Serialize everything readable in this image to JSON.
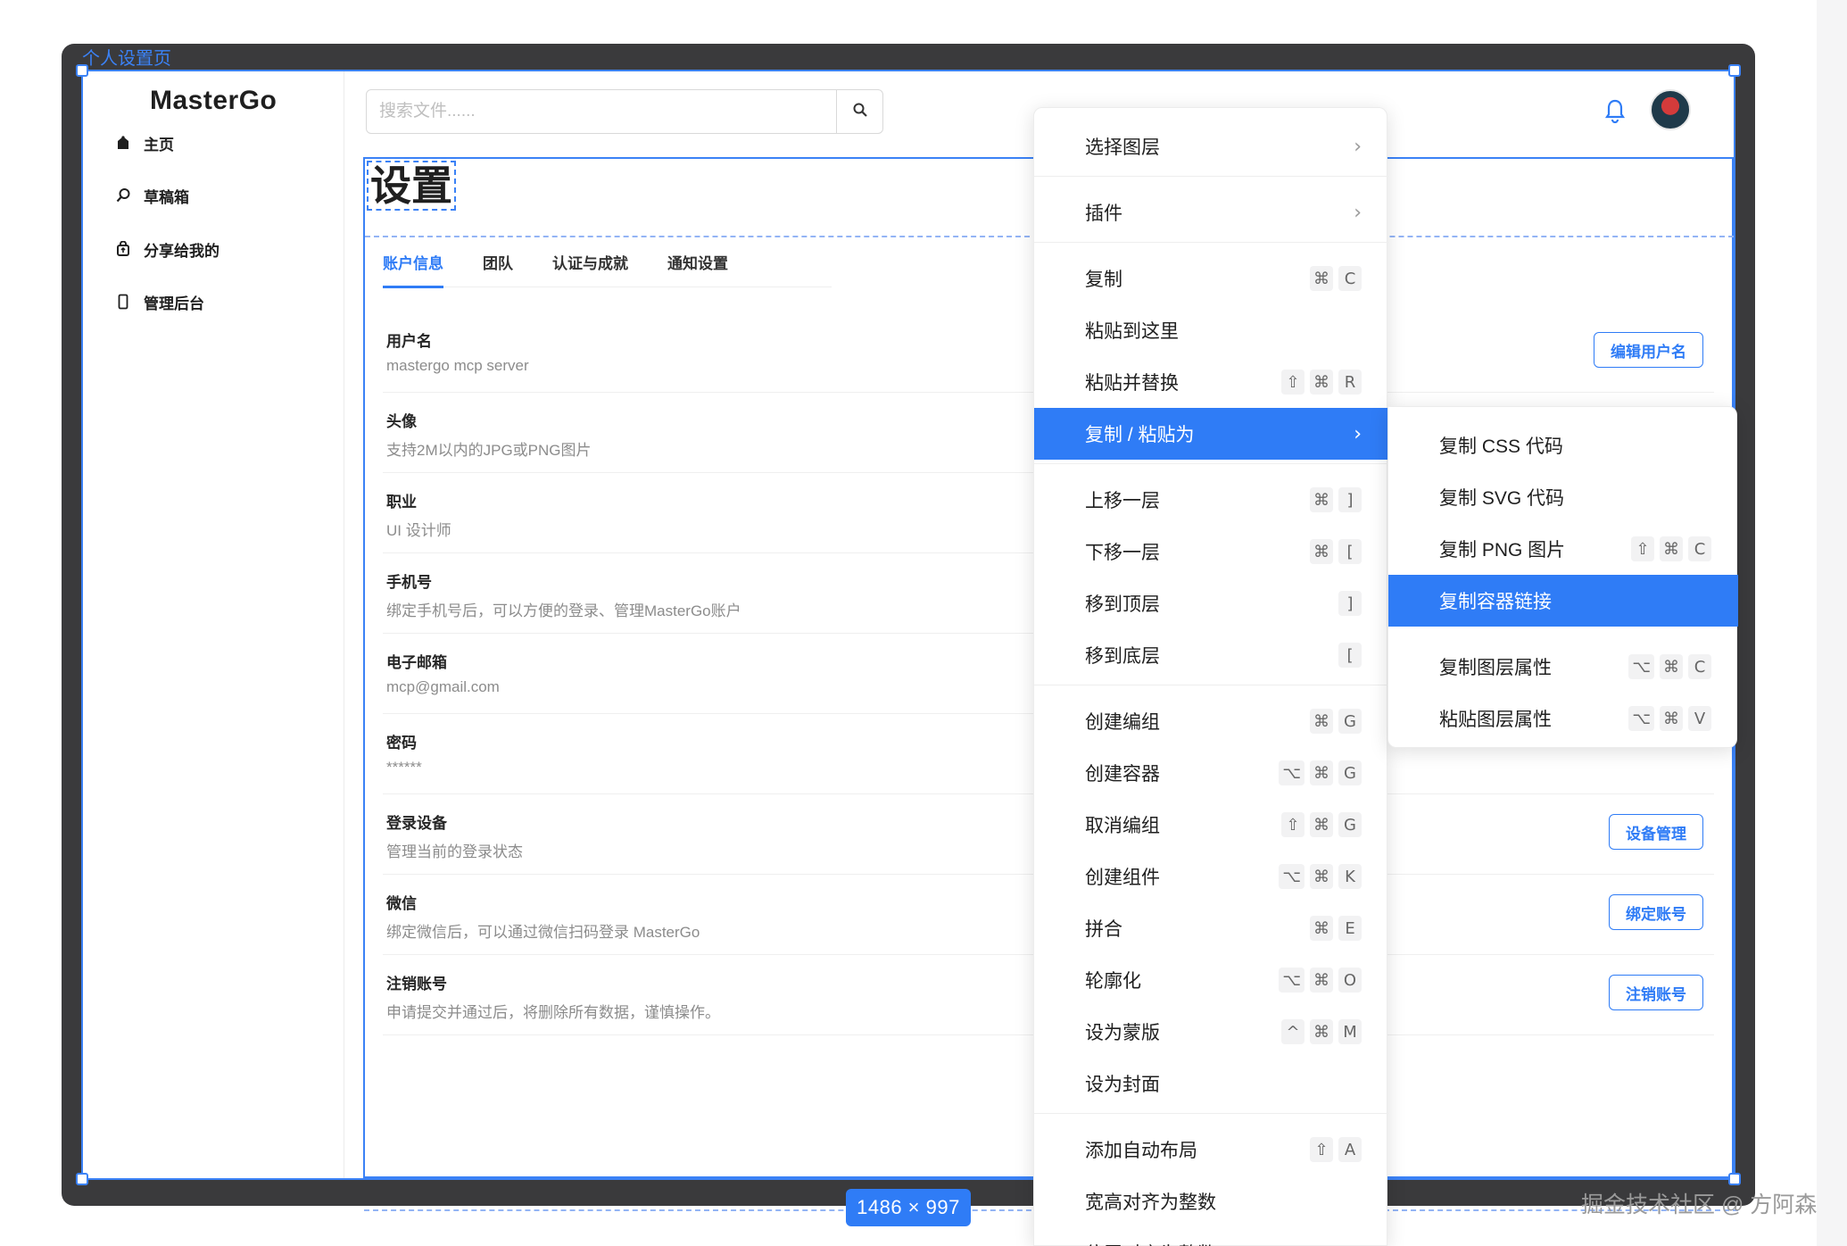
{
  "frame_title": "个人设置页",
  "size_badge": "1486 × 997",
  "watermark": "掘金技术社区 @ 方阿森",
  "sidebar": {
    "logo": "MasterGo",
    "items": [
      {
        "label": "主页",
        "icon": "home-icon"
      },
      {
        "label": "草稿箱",
        "icon": "search-icon"
      },
      {
        "label": "分享给我的",
        "icon": "share-icon"
      },
      {
        "label": "管理后台",
        "icon": "phone-icon"
      }
    ]
  },
  "header": {
    "search_placeholder": "搜索文件......",
    "bell_icon": "bell-icon",
    "avatar": "user-avatar",
    "accent": "#2f7cf6"
  },
  "page": {
    "title": "设置",
    "tabs": [
      "账户信息",
      "团队",
      "认证与成就",
      "通知设置"
    ],
    "active_tab": 0,
    "rows": [
      {
        "label": "用户名",
        "desc": "mastergo mcp server",
        "button": "编辑用户名"
      },
      {
        "label": "头像",
        "desc": "支持2M以内的JPG或PNG图片",
        "button": ""
      },
      {
        "label": "职业",
        "desc": "UI 设计师",
        "button": ""
      },
      {
        "label": "手机号",
        "desc": "绑定手机号后，可以方便的登录、管理MasterGo账户",
        "button": ""
      },
      {
        "label": "电子邮箱",
        "desc": "mcp@gmail.com",
        "button": ""
      },
      {
        "label": "密码",
        "desc": "******",
        "button": ""
      },
      {
        "label": "登录设备",
        "desc": "管理当前的登录状态",
        "button": "设备管理"
      },
      {
        "label": "微信",
        "desc": "绑定微信后，可以通过微信扫码登录 MasterGo",
        "button": "绑定账号"
      },
      {
        "label": "注销账号",
        "desc": "申请提交并通过后，将删除所有数据，谨慎操作。",
        "button": "注销账号"
      }
    ]
  },
  "context_menu": {
    "items": [
      {
        "label": "选择图层",
        "keys": [],
        "submenu": true
      },
      {
        "label": "插件",
        "keys": [],
        "submenu": true
      },
      {
        "label": "复制",
        "keys": [
          "⌘",
          "C"
        ]
      },
      {
        "label": "粘贴到这里",
        "keys": []
      },
      {
        "label": "粘贴并替换",
        "keys": [
          "⇧",
          "⌘",
          "R"
        ]
      },
      {
        "label": "复制 / 粘贴为",
        "keys": [],
        "submenu": true,
        "active": true
      },
      {
        "label": "上移一层",
        "keys": [
          "⌘",
          "]"
        ]
      },
      {
        "label": "下移一层",
        "keys": [
          "⌘",
          "["
        ]
      },
      {
        "label": "移到顶层",
        "keys": [
          "]"
        ]
      },
      {
        "label": "移到底层",
        "keys": [
          "["
        ]
      },
      {
        "label": "创建编组",
        "keys": [
          "⌘",
          "G"
        ]
      },
      {
        "label": "创建容器",
        "keys": [
          "⌥",
          "⌘",
          "G"
        ]
      },
      {
        "label": "取消编组",
        "keys": [
          "⇧",
          "⌘",
          "G"
        ]
      },
      {
        "label": "创建组件",
        "keys": [
          "⌥",
          "⌘",
          "K"
        ]
      },
      {
        "label": "拼合",
        "keys": [
          "⌘",
          "E"
        ]
      },
      {
        "label": "轮廓化",
        "keys": [
          "⌥",
          "⌘",
          "O"
        ]
      },
      {
        "label": "设为蒙版",
        "keys": [
          "^",
          "⌘",
          "M"
        ]
      },
      {
        "label": "设为封面",
        "keys": []
      },
      {
        "label": "添加自动布局",
        "keys": [
          "⇧",
          "A"
        ]
      },
      {
        "label": "宽高对齐为整数",
        "keys": []
      },
      {
        "label": "位置对齐为整数",
        "keys": []
      }
    ],
    "submenu": [
      {
        "label": "复制 CSS 代码",
        "keys": []
      },
      {
        "label": "复制 SVG 代码",
        "keys": []
      },
      {
        "label": "复制 PNG 图片",
        "keys": [
          "⇧",
          "⌘",
          "C"
        ]
      },
      {
        "label": "复制容器链接",
        "keys": [],
        "active": true
      },
      {
        "label": "复制图层属性",
        "keys": [
          "⌥",
          "⌘",
          "C"
        ]
      },
      {
        "label": "粘贴图层属性",
        "keys": [
          "⌥",
          "⌘",
          "V"
        ]
      }
    ]
  }
}
